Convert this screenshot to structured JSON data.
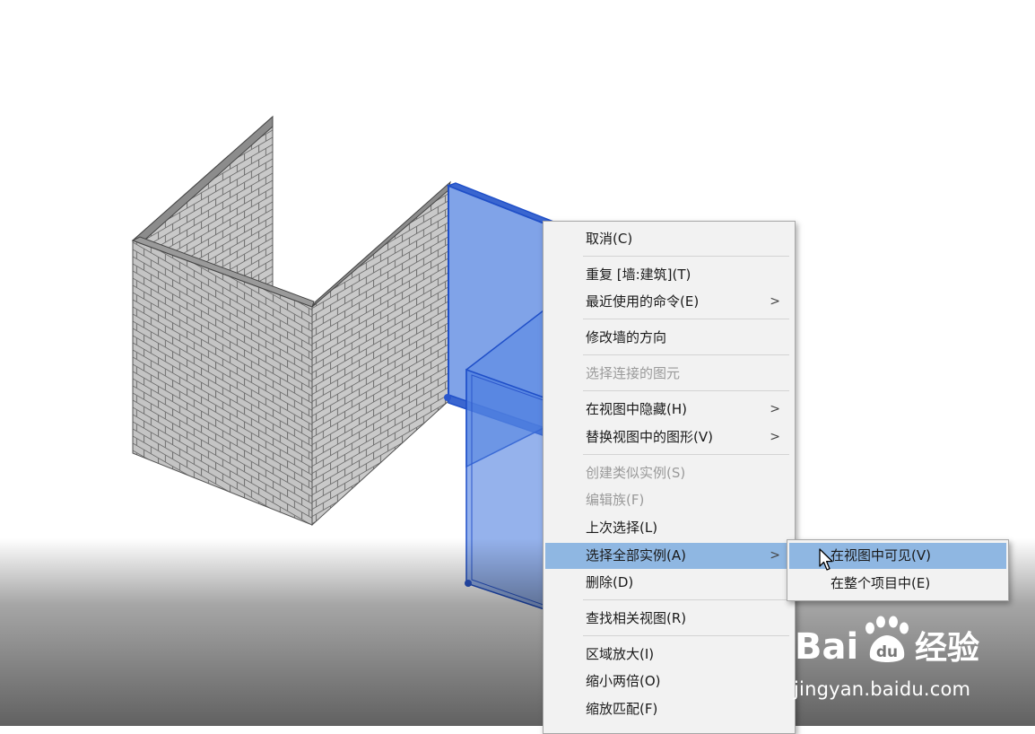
{
  "colors": {
    "background": "#ffffff",
    "menu_bg": "#f2f2f2",
    "highlight": "#8fb7e2",
    "selected_wall": "#4f7fdf",
    "brick_wall": "#c8c8c8"
  },
  "context_menu": {
    "items": [
      {
        "label": "取消(C)",
        "enabled": true
      },
      {
        "label": "重复 [墙:建筑](T)",
        "enabled": true
      },
      {
        "label": "最近使用的命令(E)",
        "enabled": true,
        "submenu": true
      },
      {
        "label": "修改墙的方向",
        "enabled": true
      },
      {
        "label": "选择连接的图元",
        "enabled": false
      },
      {
        "label": "在视图中隐藏(H)",
        "enabled": true,
        "submenu": true
      },
      {
        "label": "替换视图中的图形(V)",
        "enabled": true,
        "submenu": true
      },
      {
        "label": "创建类似实例(S)",
        "enabled": false
      },
      {
        "label": "编辑族(F)",
        "enabled": false
      },
      {
        "label": "上次选择(L)",
        "enabled": true
      },
      {
        "label": "选择全部实例(A)",
        "enabled": true,
        "submenu": true,
        "highlighted": true
      },
      {
        "label": "删除(D)",
        "enabled": true
      },
      {
        "label": "查找相关视图(R)",
        "enabled": true
      },
      {
        "label": "区域放大(I)",
        "enabled": true
      },
      {
        "label": "缩小两倍(O)",
        "enabled": true
      },
      {
        "label": "缩放匹配(F)",
        "enabled": true
      }
    ],
    "submenu_arrow": ">"
  },
  "submenu": {
    "items": [
      {
        "label": "在视图中可见(V)",
        "highlighted": true
      },
      {
        "label": "在整个项目中(E)",
        "highlighted": false
      }
    ]
  },
  "icons": {
    "cursor": "mouse-pointer-icon",
    "logo": "baidu-paw-logo"
  },
  "watermark": {
    "logo_text_left": "Bai",
    "logo_text_paw": "du",
    "logo_text_right": "经验",
    "url": "jingyan.baidu.com"
  }
}
